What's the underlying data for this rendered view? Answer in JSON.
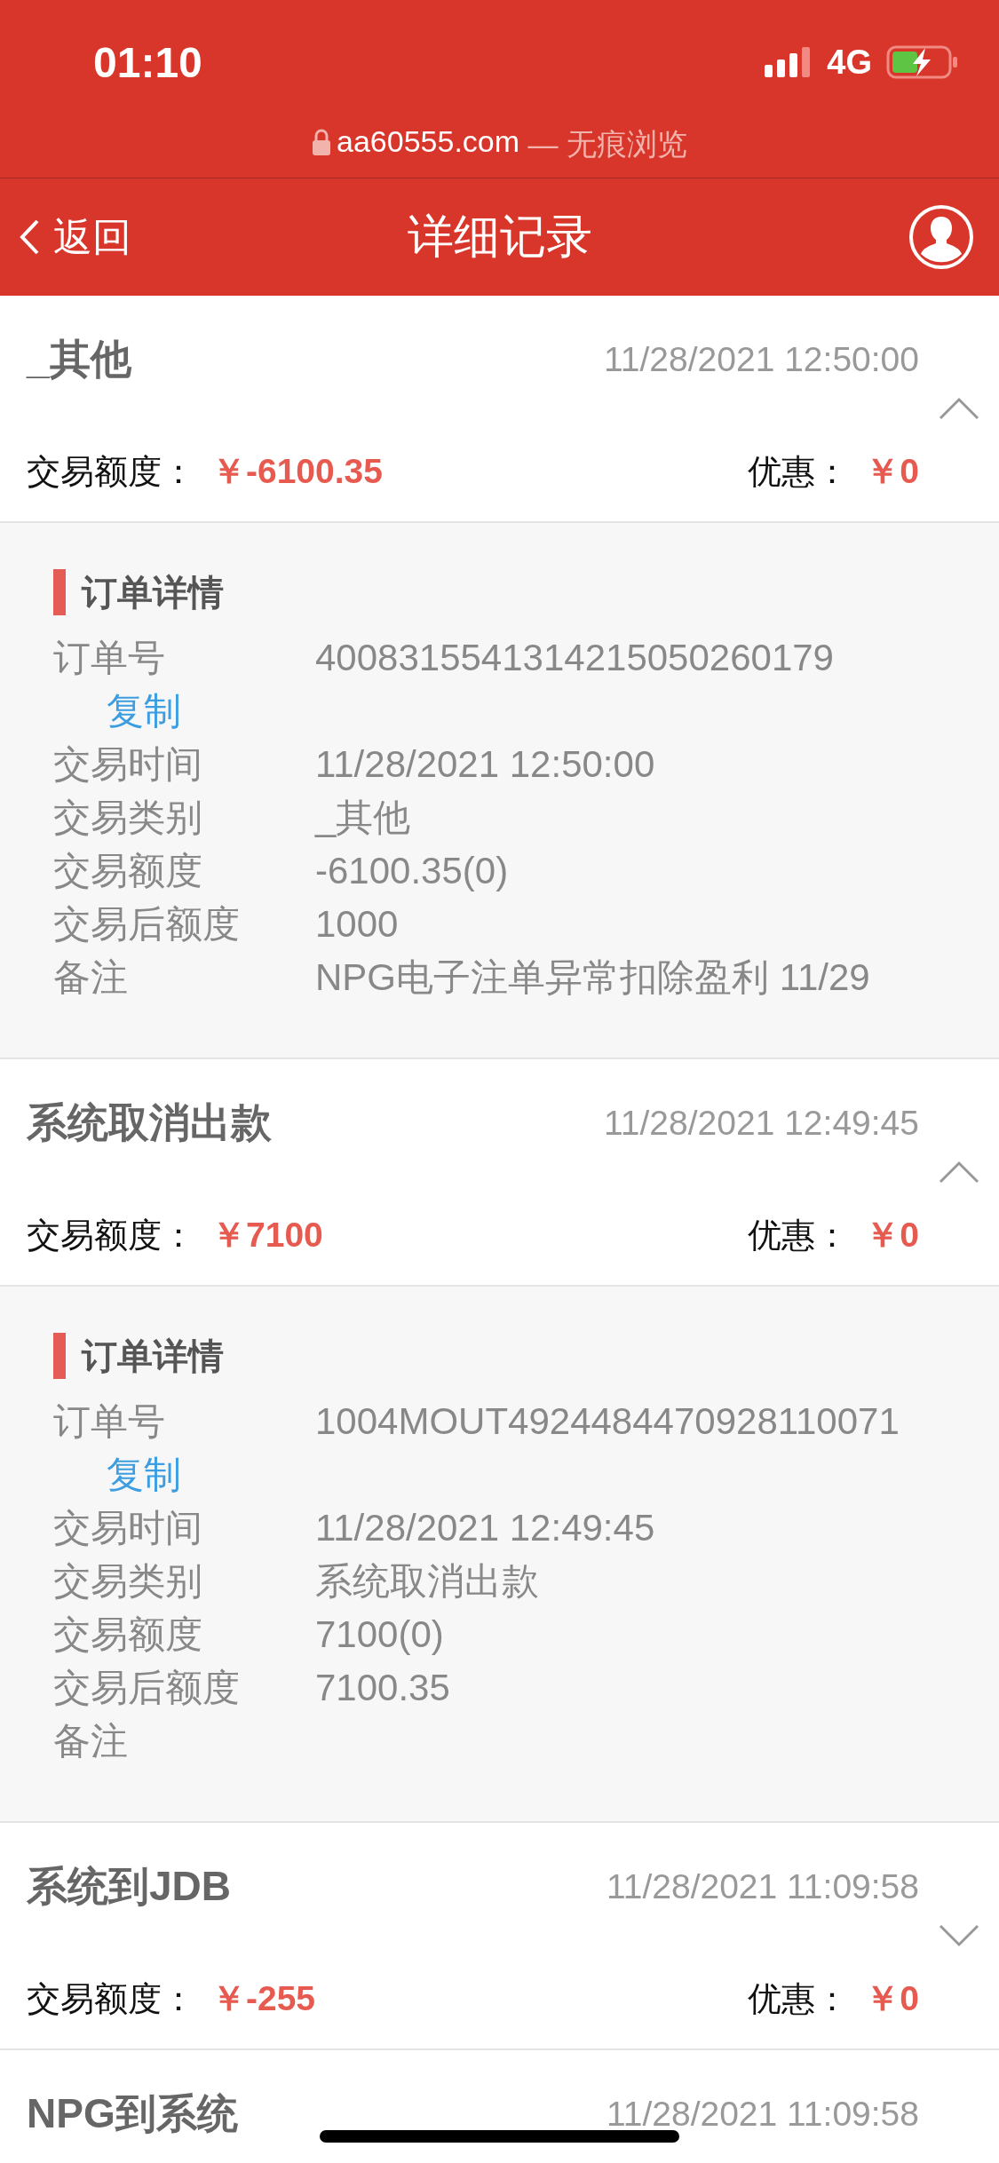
{
  "status_bar": {
    "time": "01:10",
    "network": "4G"
  },
  "browser_bar": {
    "domain": "aa60555.com",
    "mode": " — 无痕浏览"
  },
  "nav": {
    "back": "返回",
    "title": "详细记录"
  },
  "records": [
    {
      "title": "_其他",
      "time": "11/28/2021 12:50:00",
      "expanded": true,
      "amount_label": "交易额度：",
      "amount": "￥-6100.35",
      "bonus_label": "优惠：",
      "bonus": "￥0",
      "details": {
        "heading": "订单详情",
        "rows": [
          {
            "label": "订单号",
            "value": "4008315541314215050260179",
            "copy": "复制"
          },
          {
            "label": "交易时间",
            "value": "11/28/2021 12:50:00"
          },
          {
            "label": "交易类别",
            "value": "_其他"
          },
          {
            "label": "交易额度",
            "value": "-6100.35(0)"
          },
          {
            "label": "交易后额度",
            "value": "1000"
          },
          {
            "label": "备注",
            "value": "NPG电子注单异常扣除盈利 11/29"
          }
        ]
      }
    },
    {
      "title": "系统取消出款",
      "time": "11/28/2021 12:49:45",
      "expanded": true,
      "amount_label": "交易额度：",
      "amount": "￥7100",
      "bonus_label": "优惠：",
      "bonus": "￥0",
      "details": {
        "heading": "订单详情",
        "rows": [
          {
            "label": "订单号",
            "value": "1004MOUT4924484470928110071",
            "copy": "复制"
          },
          {
            "label": "交易时间",
            "value": "11/28/2021 12:49:45"
          },
          {
            "label": "交易类别",
            "value": "系统取消出款"
          },
          {
            "label": "交易额度",
            "value": "7100(0)"
          },
          {
            "label": "交易后额度",
            "value": "7100.35"
          },
          {
            "label": "备注"
          }
        ]
      }
    },
    {
      "title": "系统到JDB",
      "time": "11/28/2021 11:09:58",
      "expanded": false,
      "amount_label": "交易额度：",
      "amount": "￥-255",
      "bonus_label": "优惠：",
      "bonus": "￥0"
    },
    {
      "title": "NPG到系统",
      "time": "11/28/2021 11:09:58"
    }
  ]
}
